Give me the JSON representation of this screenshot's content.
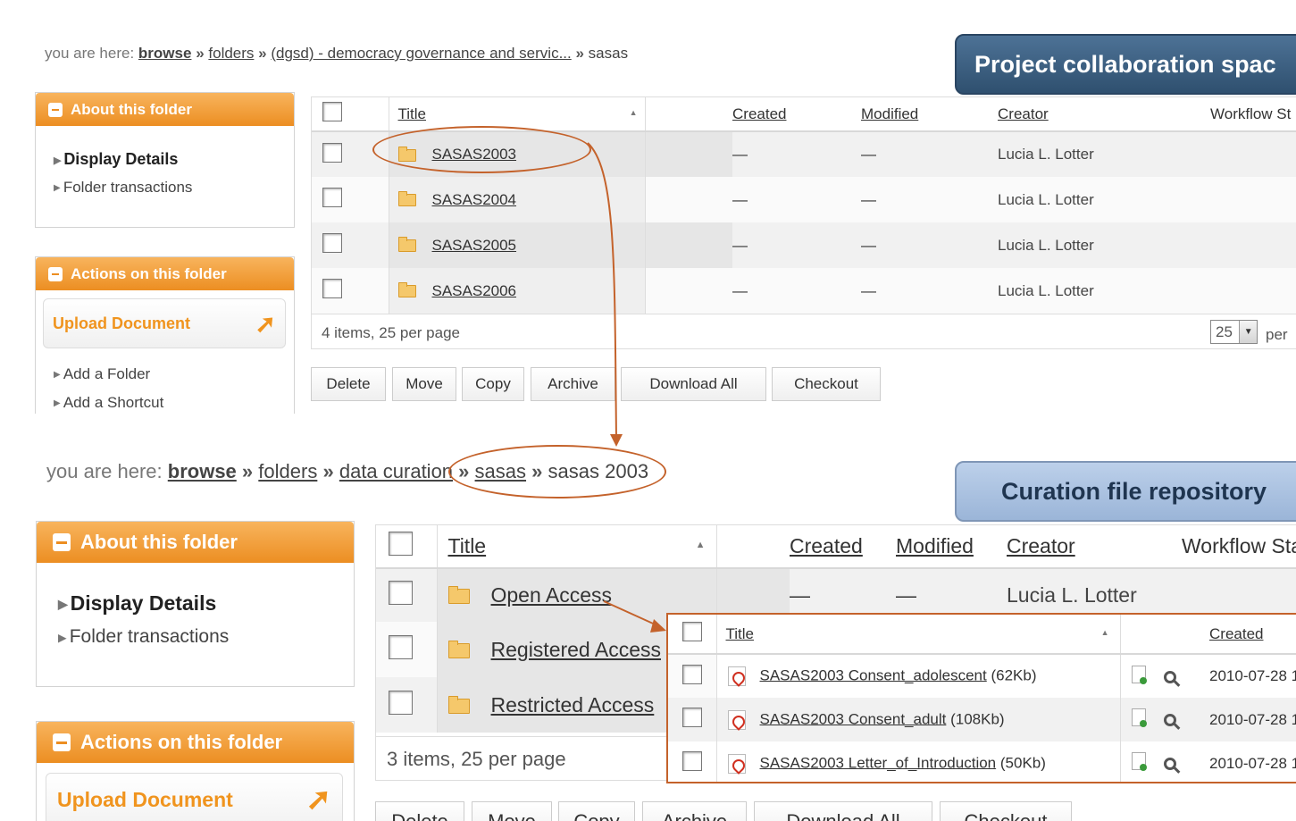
{
  "top": {
    "breadcrumb": {
      "prefix": "you are here:",
      "items": [
        "browse",
        "folders",
        "(dgsd) - democracy governance and servic...",
        "sasas"
      ],
      "sep": "»"
    },
    "banner": "Project collaboration spac",
    "about_title": "About this folder",
    "about_links": [
      "Display Details",
      "Folder transactions"
    ],
    "actions_title": "Actions on this folder",
    "upload_label": "Upload Document",
    "action_links": [
      "Add a Folder",
      "Add a Shortcut"
    ],
    "columns": [
      "Title",
      "Created",
      "Modified",
      "Creator",
      "Workflow St"
    ],
    "rows": [
      {
        "title": "SASAS2003",
        "created": "—",
        "modified": "—",
        "creator": "Lucia L. Lotter"
      },
      {
        "title": "SASAS2004",
        "created": "—",
        "modified": "—",
        "creator": "Lucia L. Lotter"
      },
      {
        "title": "SASAS2005",
        "created": "—",
        "modified": "—",
        "creator": "Lucia L. Lotter"
      },
      {
        "title": "SASAS2006",
        "created": "—",
        "modified": "—",
        "creator": "Lucia L. Lotter"
      }
    ],
    "footer": "4 items, 25 per page",
    "per_page_value": "25",
    "per_page_suffix": "per p",
    "buttons": [
      "Delete",
      "Move",
      "Copy",
      "Archive",
      "Download All",
      "Checkout"
    ]
  },
  "bottom": {
    "breadcrumb": {
      "prefix": "you are here:",
      "items": [
        "browse",
        "folders",
        "data curation",
        "sasas"
      ],
      "current": "sasas 2003",
      "sep": "»"
    },
    "banner": "Curation file repository",
    "about_title": "About this folder",
    "about_links": [
      "Display Details",
      "Folder transactions"
    ],
    "actions_title": "Actions on this folder",
    "upload_label": "Upload Document",
    "columns": [
      "Title",
      "Created",
      "Modified",
      "Creator",
      "Workflow Sta"
    ],
    "rows": [
      {
        "title": "Open Access",
        "created": "—",
        "modified": "—",
        "creator": "Lucia L. Lotter"
      },
      {
        "title": "Registered Access"
      },
      {
        "title": "Restricted Access"
      }
    ],
    "footer": "3 items, 25 per page",
    "buttons": [
      "Delete",
      "Move",
      "Copy",
      "Archive",
      "Download All",
      "Checkout"
    ]
  },
  "inset": {
    "columns": [
      "Title",
      "Created"
    ],
    "files": [
      {
        "name": "SASAS2003 Consent_adolescent",
        "size": "(62Kb)",
        "created": "2010-07-28 1"
      },
      {
        "name": "SASAS2003 Consent_adult",
        "size": "(108Kb)",
        "created": "2010-07-28 1"
      },
      {
        "name": "SASAS2003 Letter_of_Introduction",
        "size": "(50Kb)",
        "created": "2010-07-28 1"
      }
    ]
  },
  "colors": {
    "accent": "#ec8e22",
    "annotation": "#c4622b",
    "banner_dark": "#3d5f80",
    "banner_light": "#a9c1df"
  }
}
